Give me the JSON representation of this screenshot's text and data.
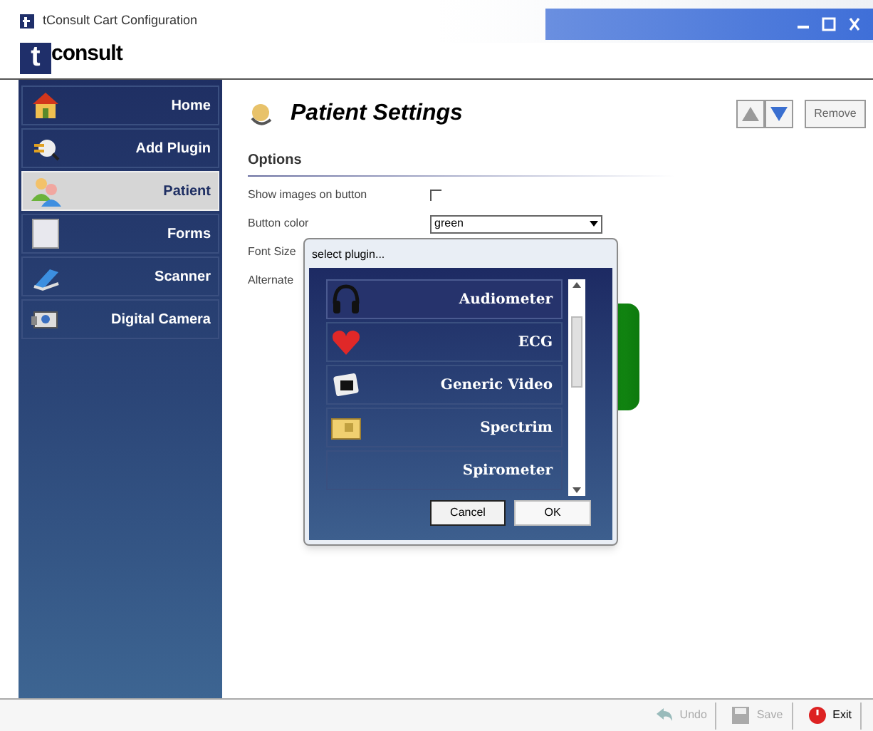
{
  "window": {
    "title": "tConsult Cart Configuration"
  },
  "logo": {
    "mark": "t",
    "text": "consult"
  },
  "sidebar": {
    "items": [
      {
        "label": "Home",
        "selected": false
      },
      {
        "label": "Add Plugin",
        "selected": false
      },
      {
        "label": "Patient",
        "selected": true
      },
      {
        "label": "Forms",
        "selected": false
      },
      {
        "label": "Scanner",
        "selected": false
      },
      {
        "label": "Digital Camera",
        "selected": false
      }
    ]
  },
  "header": {
    "title": "Patient Settings",
    "move_up": {
      "disabled": true
    },
    "move_down": {
      "disabled": false
    },
    "remove": "Remove"
  },
  "options": {
    "heading": "Options",
    "fields": [
      {
        "kind": "checkbox",
        "label": "Show images on button",
        "checked": false
      },
      {
        "kind": "select",
        "label": "Button color",
        "value": "green"
      },
      {
        "kind": "label",
        "label": "Font Size"
      },
      {
        "kind": "label",
        "label": "Alternate"
      }
    ]
  },
  "dialog": {
    "title": "select plugin...",
    "items": [
      {
        "label": "Audiometer",
        "selected": true
      },
      {
        "label": "ECG",
        "selected": false
      },
      {
        "label": "Generic Video",
        "selected": false
      },
      {
        "label": "Spectrim",
        "selected": false
      },
      {
        "label": "Spirometer",
        "selected": false
      }
    ],
    "cancel": "Cancel",
    "ok": "OK"
  },
  "footer": {
    "buttons": [
      {
        "label": "Undo",
        "disabled": true
      },
      {
        "label": "Save",
        "disabled": true
      },
      {
        "label": "Exit",
        "disabled": false
      }
    ]
  }
}
